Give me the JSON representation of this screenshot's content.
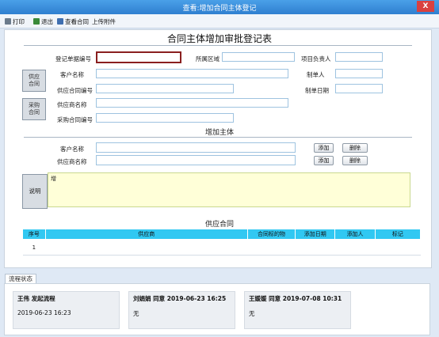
{
  "window": {
    "title": "查看:增加合同主体登记",
    "close": "X"
  },
  "toolbar": {
    "print": "打印",
    "exit": "退出",
    "view_contract": "查看合同",
    "upload": "上传附件"
  },
  "form": {
    "heading": "合同主体增加审批登记表",
    "reg_no_label": "登记单据编号",
    "region_label": "所属区域",
    "project_lead_label": "项目负责人",
    "supply_side_btn": "供应\n合同",
    "customer_label": "客户名称",
    "maker_label": "制单人",
    "supply_contract_no_label": "供应合同编号",
    "make_date_label": "制单日期",
    "purchase_side_btn": "采购\n合同",
    "supplier_label": "供应商名称",
    "purchase_contract_no_label": "采购合同编号"
  },
  "add_subject": {
    "heading": "增加主体",
    "customer_label": "客户名称",
    "supplier_label": "供应商名称",
    "add_btn": "添加",
    "delete_btn": "删除"
  },
  "description": {
    "label": "说明",
    "prefix": "增"
  },
  "supply_contract": {
    "heading": "供应合同",
    "columns": [
      "序号",
      "供应商",
      "合同标的物",
      "添加日期",
      "添加人",
      "标记"
    ],
    "rows": [
      {
        "no": "1",
        "supplier": "..."
      }
    ]
  },
  "flow": {
    "tab": "流程状态",
    "steps": [
      {
        "header": "王伟 发起流程",
        "text": "2019-06-23 16:23"
      },
      {
        "header": "刘娟娟 同意 2019-06-23 16:25",
        "text": "无"
      },
      {
        "header": "王媛媛 同意 2019-07-08 10:31",
        "text": "无"
      }
    ]
  }
}
